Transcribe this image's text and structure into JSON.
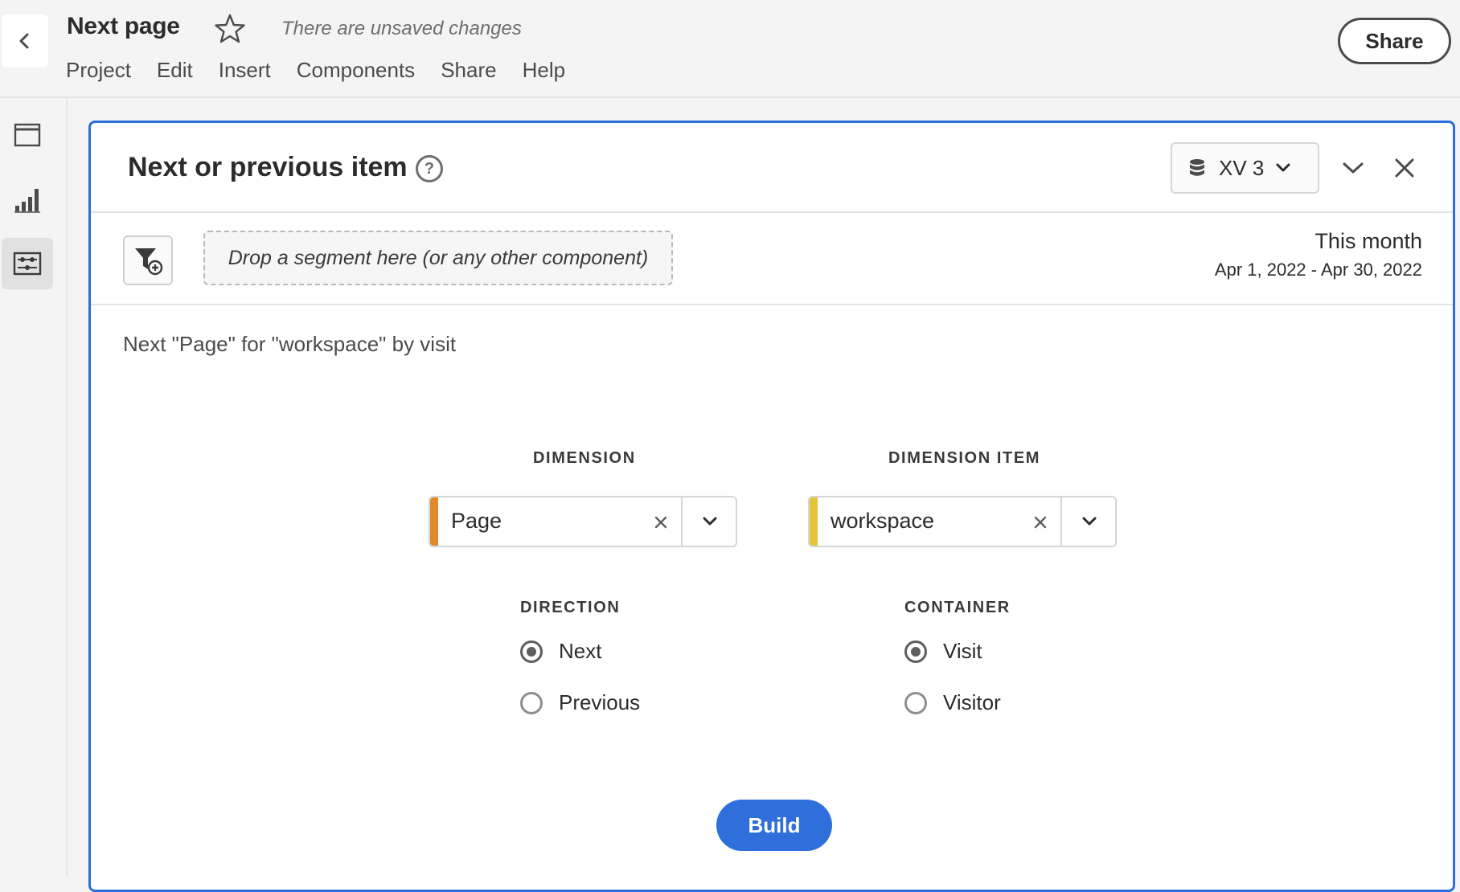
{
  "header": {
    "project_title": "Next page",
    "unsaved_notice": "There are unsaved changes",
    "menu": [
      "Project",
      "Edit",
      "Insert",
      "Components",
      "Share",
      "Help"
    ],
    "share_label": "Share"
  },
  "rail": {
    "items": [
      {
        "icon": "panel-icon",
        "active": false
      },
      {
        "icon": "visualizations-icon",
        "active": false
      },
      {
        "icon": "components-icon",
        "active": true
      }
    ]
  },
  "panel": {
    "title": "Next or previous item",
    "report_suite": "XV 3",
    "segment_dropzone": "Drop a segment here (or any other component)",
    "date_title": "This month",
    "date_range": "Apr 1, 2022 - Apr 30, 2022",
    "summary": "Next \"Page\" for \"workspace\" by visit",
    "dimension": {
      "label": "DIMENSION",
      "value": "Page",
      "color": "#e08a2e"
    },
    "dimension_item": {
      "label": "DIMENSION ITEM",
      "value": "workspace",
      "color": "#e4c53a"
    },
    "direction": {
      "label": "DIRECTION",
      "options": [
        "Next",
        "Previous"
      ],
      "selected": "Next"
    },
    "container": {
      "label": "CONTAINER",
      "options": [
        "Visit",
        "Visitor"
      ],
      "selected": "Visit"
    },
    "build_label": "Build"
  },
  "colors": {
    "accent": "#2f6fdc",
    "panel_border": "#2a6fdb"
  }
}
